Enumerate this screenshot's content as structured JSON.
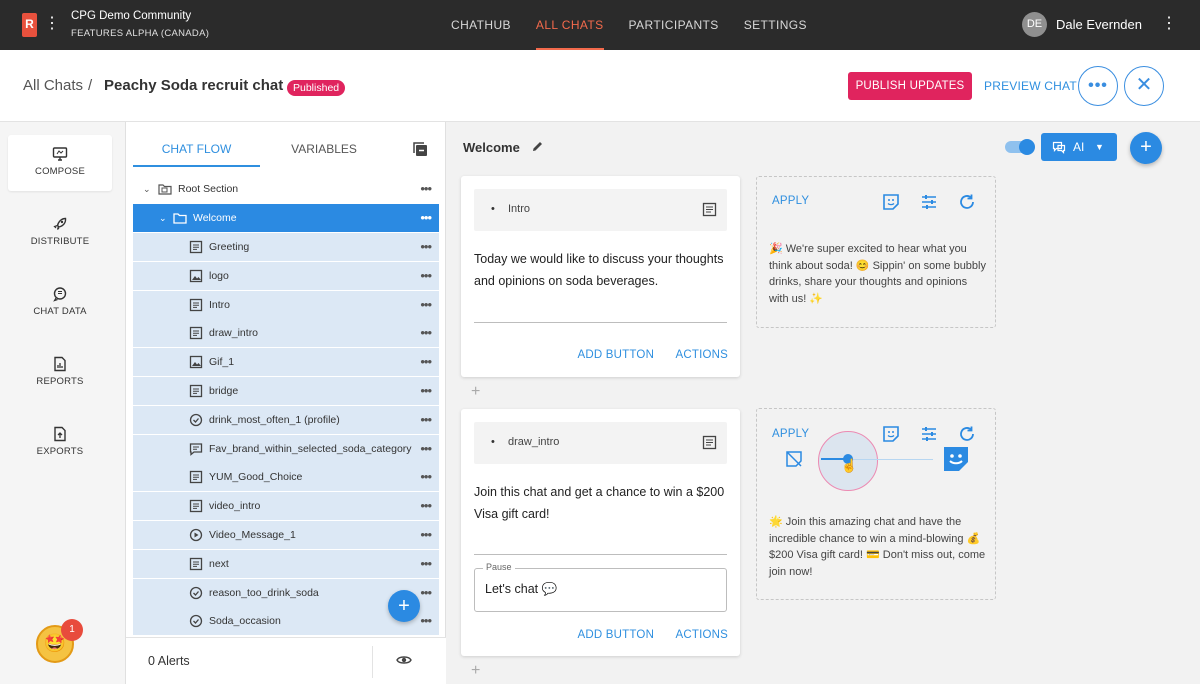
{
  "topbar": {
    "logo": "R",
    "org_name": "CPG Demo Community",
    "org_sub": "FEATURES ALPHA (CANADA)",
    "nav": [
      "CHATHUB",
      "ALL CHATS",
      "PARTICIPANTS",
      "SETTINGS"
    ],
    "active_nav": "ALL CHATS",
    "user_initials": "DE",
    "user_name": "Dale Evernden"
  },
  "header": {
    "crumb_all": "All Chats",
    "crumb_sep": "/",
    "chat_title": "Peachy Soda recruit chat",
    "status_badge": "Published",
    "publish_label": "PUBLISH UPDATES",
    "preview_label": "PREVIEW CHAT"
  },
  "rail": {
    "items": [
      {
        "label": "COMPOSE",
        "icon": "monitor-icon"
      },
      {
        "label": "DISTRIBUTE",
        "icon": "rocket-icon"
      },
      {
        "label": "CHAT DATA",
        "icon": "chat-bubble-icon"
      },
      {
        "label": "REPORTS",
        "icon": "report-icon"
      },
      {
        "label": "EXPORTS",
        "icon": "export-icon"
      }
    ],
    "notification_count": "1"
  },
  "tree": {
    "tabs": [
      "CHAT FLOW",
      "VARIABLES"
    ],
    "active_tab": "CHAT FLOW",
    "root_label": "Root Section",
    "section_label": "Welcome",
    "items": [
      {
        "label": "Greeting",
        "icon": "text-block-icon"
      },
      {
        "label": "logo",
        "icon": "image-icon"
      },
      {
        "label": "Intro",
        "icon": "text-block-icon"
      },
      {
        "label": "draw_intro",
        "icon": "text-block-icon"
      },
      {
        "label": "Gif_1",
        "icon": "image-icon"
      },
      {
        "label": "bridge",
        "icon": "text-block-icon"
      },
      {
        "label": "drink_most_often_1 (profile)",
        "icon": "check-circle-icon"
      },
      {
        "label": "Fav_brand_within_selected_soda_category",
        "icon": "chat-icon"
      },
      {
        "label": "YUM_Good_Choice",
        "icon": "text-block-icon"
      },
      {
        "label": "video_intro",
        "icon": "text-block-icon"
      },
      {
        "label": "Video_Message_1",
        "icon": "play-circle-icon"
      },
      {
        "label": "next",
        "icon": "text-block-icon"
      },
      {
        "label": "reason_too_drink_soda",
        "icon": "check-circle-icon"
      },
      {
        "label": "Soda_occasion",
        "icon": "check-circle-icon"
      }
    ],
    "alerts": "0 Alerts"
  },
  "main": {
    "section_title": "Welcome",
    "ai_label": "AI",
    "ai_toggle_on": true,
    "cards": [
      {
        "name": "Intro",
        "body": "Today we would like to discuss your thoughts and opinions on soda beverages.",
        "add_button": "ADD BUTTON",
        "actions": "ACTIONS"
      },
      {
        "name": "draw_intro",
        "body": "Join this chat and get a chance to win a $200 Visa gift card!",
        "pause_label": "Pause",
        "pause_value": "Let's chat 💬",
        "add_button": "ADD BUTTON",
        "actions": "ACTIONS"
      }
    ],
    "ai_panels": [
      {
        "apply": "APPLY",
        "text": "🎉 We're super excited to hear what you think about soda! 😊 Sippin' on some bubbly drinks, share your thoughts and opinions with us! ✨"
      },
      {
        "apply": "APPLY",
        "text": "🌟 Join this amazing chat and have the incredible chance to win a mind-blowing 💰 $200 Visa gift card! 💳 Don't miss out, come join now!",
        "emoji_level": 0.2
      }
    ]
  },
  "colors": {
    "accent": "#2b8ae2",
    "brand": "#e0245e",
    "nav_active": "#f36a4c",
    "topbar_bg": "#2b2b2b"
  }
}
